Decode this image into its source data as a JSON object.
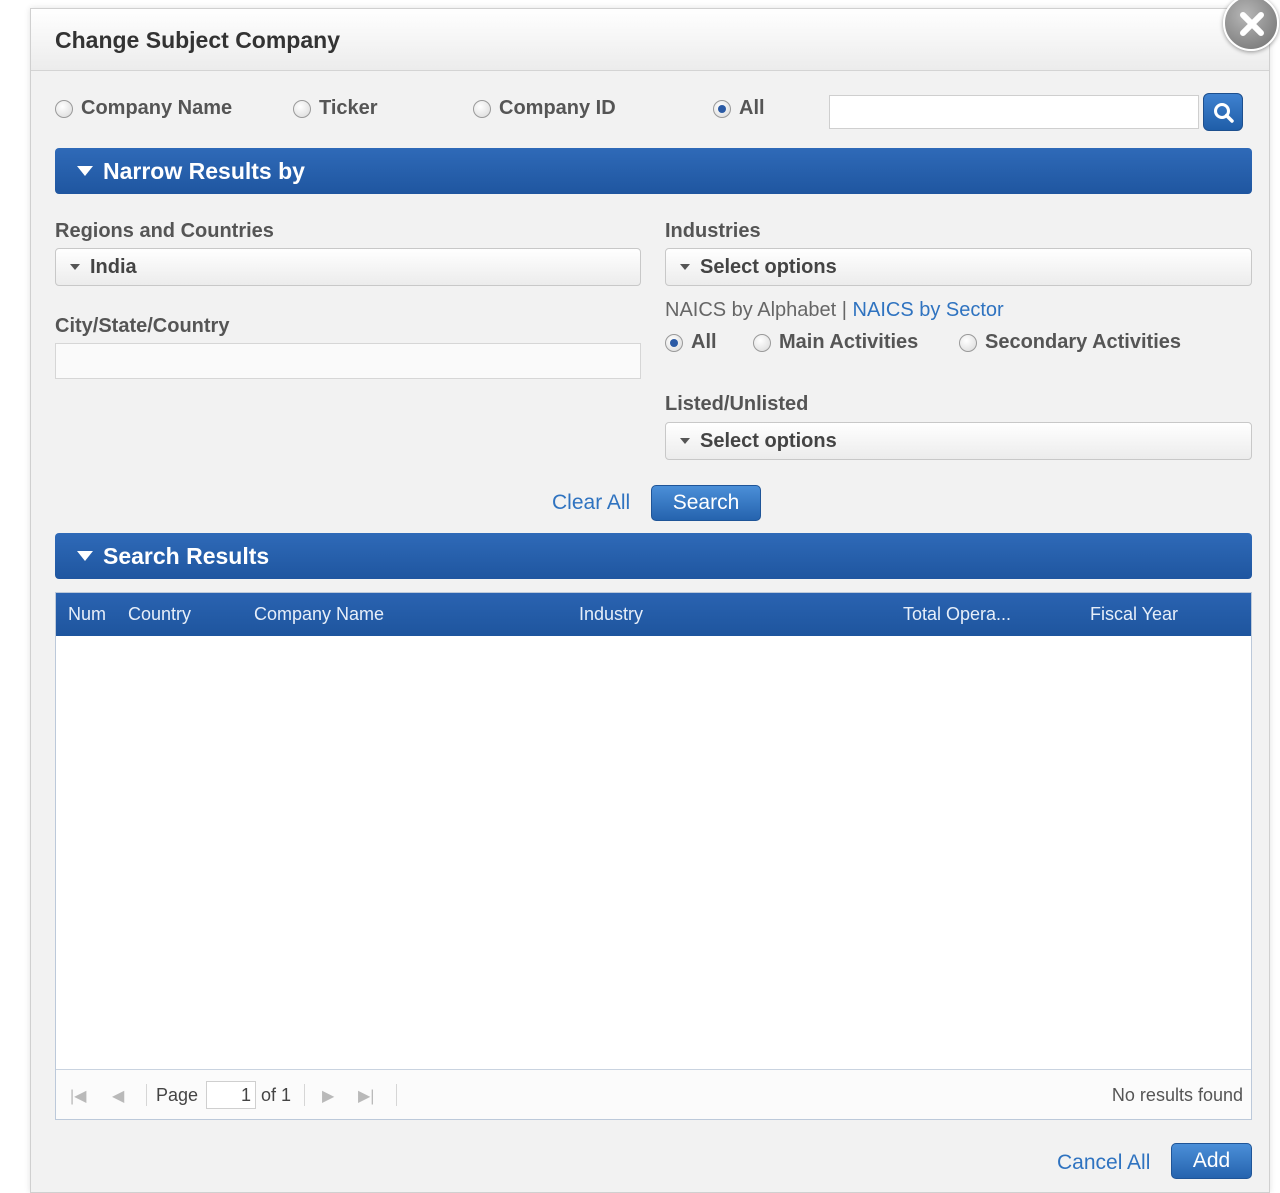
{
  "dialog": {
    "title": "Change Subject Company"
  },
  "search_by": {
    "options": [
      "Company Name",
      "Ticker",
      "Company ID",
      "All"
    ],
    "selected": "All",
    "query": "",
    "search_icon": "search-icon"
  },
  "narrow": {
    "header": "Narrow Results by",
    "regions_label": "Regions and Countries",
    "regions_value": "India",
    "city_label": "City/State/Country",
    "city_value": "",
    "industries_label": "Industries",
    "industries_value": "Select options",
    "naics_alphabet": "NAICS by Alphabet",
    "naics_sep": " | ",
    "naics_sector": "NAICS by Sector",
    "activity_options": [
      "All",
      "Main Activities",
      "Secondary Activities"
    ],
    "activity_selected": "All",
    "listed_label": "Listed/Unlisted",
    "listed_value": "Select options",
    "clear_all": "Clear All",
    "search_button": "Search"
  },
  "results": {
    "header": "Search Results",
    "columns": [
      "Num",
      "Country",
      "Company Name",
      "Industry",
      "Total Opera...",
      "Fiscal Year"
    ],
    "rows": [],
    "pager": {
      "page_label": "Page",
      "page_value": "1",
      "of_label": "of 1",
      "status": "No results found"
    }
  },
  "footer": {
    "cancel_all": "Cancel All",
    "add": "Add"
  },
  "colors": {
    "accent": "#1f56a0",
    "link": "#2f73c0"
  }
}
